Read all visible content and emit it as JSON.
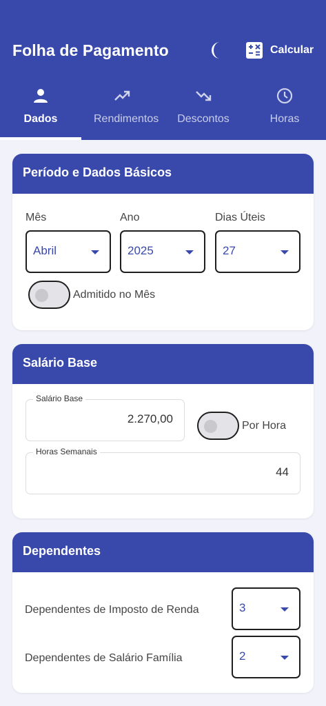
{
  "header": {
    "title": "Folha de Pagamento",
    "calculate_label": "Calcular"
  },
  "tabs": [
    {
      "label": "Dados",
      "icon": "person-icon",
      "active": true
    },
    {
      "label": "Rendimentos",
      "icon": "trending-up-icon",
      "active": false
    },
    {
      "label": "Descontos",
      "icon": "trending-down-icon",
      "active": false
    },
    {
      "label": "Horas",
      "icon": "clock-icon",
      "active": false
    }
  ],
  "periodo": {
    "title": "Período e Dados Básicos",
    "mes": {
      "label": "Mês",
      "value": "Abril"
    },
    "ano": {
      "label": "Ano",
      "value": "2025"
    },
    "dias": {
      "label": "Dias Úteis",
      "value": "27"
    },
    "admitido": {
      "label": "Admitido no Mês",
      "on": false
    }
  },
  "salario": {
    "title": "Salário Base",
    "base": {
      "label": "Salário Base",
      "value": "2.270,00"
    },
    "por_hora": {
      "label": "Por Hora",
      "on": false
    },
    "horas": {
      "label": "Horas Semanais",
      "value": "44"
    }
  },
  "dependentes": {
    "title": "Dependentes",
    "ir": {
      "label": "Dependentes de Imposto de Renda",
      "value": "3"
    },
    "sf": {
      "label": "Dependentes de Salário Família",
      "value": "2"
    }
  },
  "colors": {
    "primary": "#3949ab",
    "background": "#f2f3fa"
  }
}
